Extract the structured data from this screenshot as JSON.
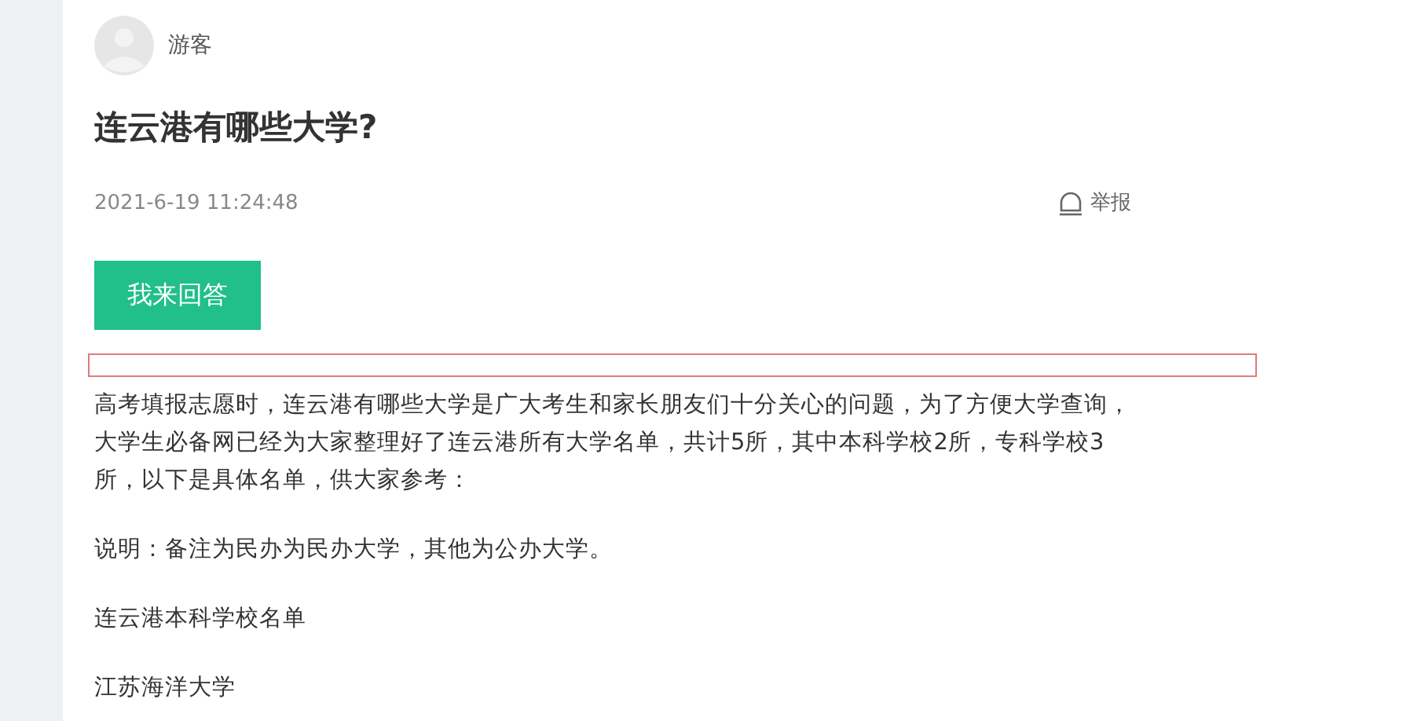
{
  "author": {
    "name": "游客"
  },
  "question": {
    "title": "连云港有哪些大学?",
    "time": "2021-6-19 11:24:48",
    "report": "举报"
  },
  "answer_button": "我来回答",
  "paragraphs": [
    "高考填报志愿时，连云港有哪些大学是广大考生和家长朋友们十分关心的问题，为了方便大学查询，大学生必备网已经为大家整理好了连云港所有大学名单，共计5所，其中本科学校2所，专科学校3所，以下是具体名单，供大家参考：",
    "说明：备注为民办为民办大学，其他为公办大学。",
    "连云港本科学校名单",
    "江苏海洋大学"
  ]
}
